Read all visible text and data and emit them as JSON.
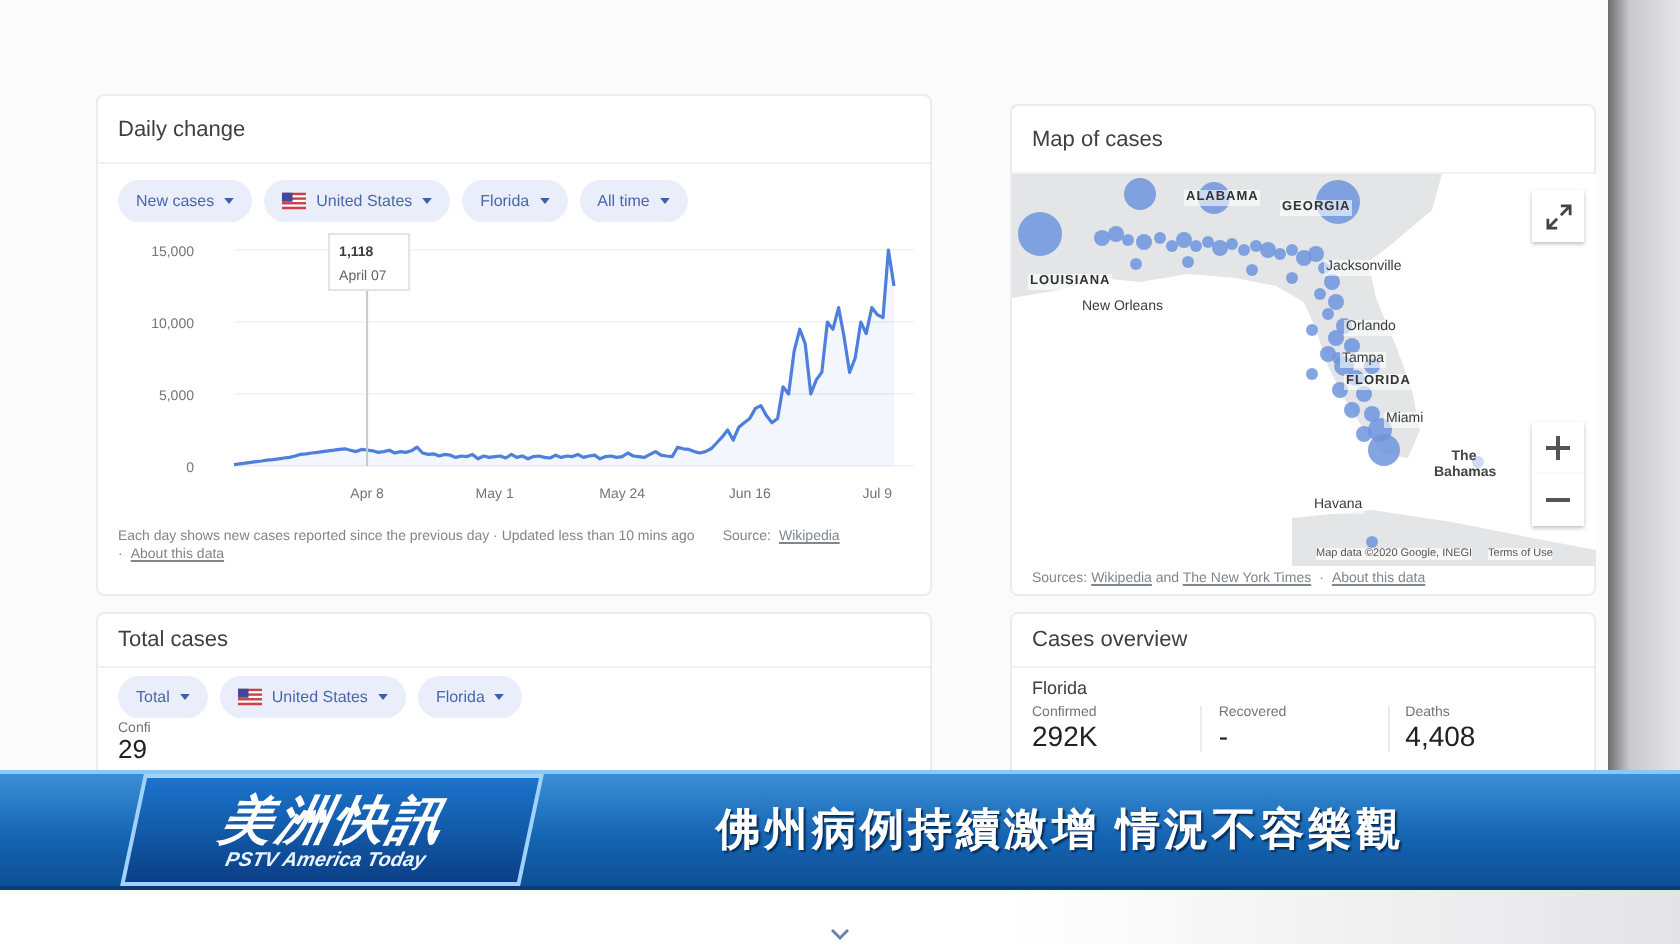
{
  "daily_change": {
    "title": "Daily change",
    "filters": [
      {
        "label": "New cases",
        "kind": "plain"
      },
      {
        "label": "United States",
        "kind": "country"
      },
      {
        "label": "Florida",
        "kind": "plain"
      },
      {
        "label": "All time",
        "kind": "plain"
      }
    ],
    "tooltip": {
      "value": "1,118",
      "date": "April 07"
    },
    "chart_data": {
      "type": "area",
      "categories": [
        null,
        null,
        null,
        null,
        null,
        null,
        null,
        null,
        null,
        null,
        null,
        null,
        null,
        null,
        null,
        null,
        null,
        null,
        null,
        null,
        null,
        null,
        null,
        null,
        "Apr 8",
        null,
        null,
        null,
        null,
        null,
        null,
        null,
        null,
        null,
        null,
        null,
        null,
        null,
        null,
        null,
        null,
        null,
        null,
        null,
        null,
        null,
        null,
        "May 1",
        null,
        null,
        null,
        null,
        null,
        null,
        null,
        null,
        null,
        null,
        null,
        null,
        null,
        null,
        null,
        null,
        null,
        null,
        null,
        null,
        null,
        null,
        "May 24",
        null,
        null,
        null,
        null,
        null,
        null,
        null,
        null,
        null,
        null,
        null,
        null,
        null,
        null,
        null,
        null,
        null,
        null,
        null,
        null,
        null,
        null,
        "Jun 16",
        null,
        null,
        null,
        null,
        null,
        null,
        null,
        null,
        null,
        null,
        null,
        null,
        null,
        null,
        null,
        null,
        null,
        null,
        null,
        null,
        null,
        null,
        "Jul 9",
        null,
        null,
        null
      ],
      "series": [
        {
          "color": "#4f7fdc",
          "values": [
            100,
            150,
            200,
            250,
            300,
            350,
            400,
            450,
            500,
            550,
            600,
            700,
            800,
            850,
            900,
            950,
            1000,
            1050,
            1100,
            1150,
            1200,
            1100,
            1000,
            1150,
            1118,
            1050,
            950,
            1000,
            1100,
            900,
            1000,
            950,
            1050,
            1300,
            900,
            800,
            850,
            700,
            800,
            750,
            600,
            700,
            650,
            800,
            500,
            700,
            600,
            650,
            700,
            550,
            800,
            600,
            700,
            500,
            650,
            700,
            600,
            550,
            750,
            600,
            700,
            650,
            800,
            600,
            700,
            750,
            500,
            650,
            700,
            600,
            650,
            900,
            700,
            650,
            600,
            800,
            1000,
            750,
            700,
            650,
            1300,
            1200,
            1150,
            1000,
            900,
            1000,
            1200,
            1600,
            2000,
            2500,
            1800,
            2700,
            3000,
            3300,
            4000,
            4200,
            3500,
            3000,
            3300,
            5500,
            5000,
            8000,
            9500,
            8500,
            5000,
            6000,
            6500,
            10000,
            9500,
            11000,
            9000,
            6500,
            7500,
            10000,
            9200,
            11000,
            10500,
            10300,
            15000,
            12500
          ]
        }
      ],
      "ylim": [
        0,
        15000
      ],
      "yticks": [
        {
          "value": 15000,
          "label": "15,000"
        },
        {
          "value": 10000,
          "label": "10,000"
        },
        {
          "value": 5000,
          "label": "5,000"
        },
        {
          "value": 0,
          "label": "0"
        }
      ]
    },
    "footnote": "Each day shows new cases reported since the previous day · Updated less than 10 mins ago",
    "source_label": "Source:",
    "source_link": "Wikipedia",
    "separator": "·",
    "about_link": "About this data"
  },
  "map": {
    "title": "Map of cases",
    "labels": [
      {
        "text": "ALABAMA",
        "kind": "state"
      },
      {
        "text": "GEORGIA",
        "kind": "state"
      },
      {
        "text": "LOUISIANA",
        "kind": "state"
      },
      {
        "text": "New Orleans",
        "kind": "city"
      },
      {
        "text": "Jacksonville",
        "kind": "city"
      },
      {
        "text": "Orlando",
        "kind": "city"
      },
      {
        "text": "Tampa",
        "kind": "city"
      },
      {
        "text": "FLORIDA",
        "kind": "state"
      },
      {
        "text": "Miami",
        "kind": "city"
      },
      {
        "text": "The Bahamas",
        "kind": "country"
      },
      {
        "text": "Havana",
        "kind": "city"
      }
    ],
    "attribution": "Map data ©2020 Google, INEGI",
    "terms": "Terms of Use",
    "sources_prefix": "Sources:",
    "sources_link_1": "Wikipedia",
    "sources_joiner": "and",
    "sources_link_2": "The New York Times",
    "separator": "·",
    "about_link": "About this data"
  },
  "total_cases": {
    "title": "Total cases",
    "filters": [
      {
        "label": "Total",
        "kind": "plain"
      },
      {
        "label": "United States",
        "kind": "country"
      },
      {
        "label": "Florida",
        "kind": "plain"
      }
    ],
    "stat_label": "Confi",
    "stat_value": "29"
  },
  "cases_overview": {
    "title": "Cases overview",
    "region": "Florida",
    "stats": [
      {
        "label": "Confirmed",
        "value": "292K"
      },
      {
        "label": "Recovered",
        "value": "-"
      },
      {
        "label": "Deaths",
        "value": "4,408"
      }
    ]
  },
  "banner": {
    "program_title": "美洲快訊",
    "program_subtitle": "PSTV America Today",
    "headline": "佛州病例持續激增 情況不容樂觀"
  }
}
